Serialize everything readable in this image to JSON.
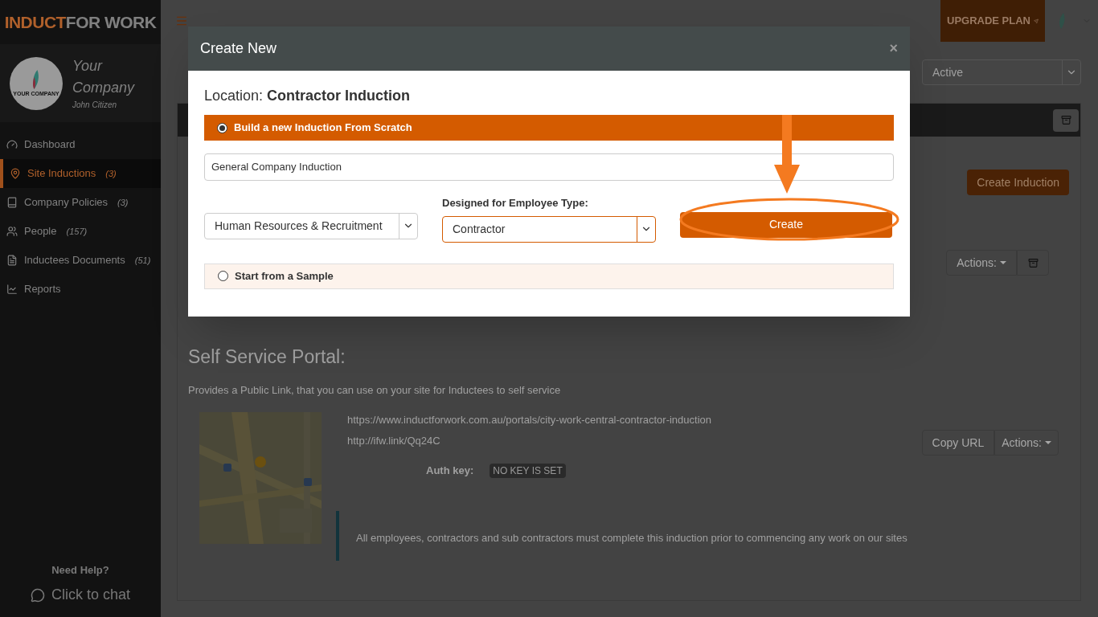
{
  "brand": {
    "logo_left": "INDUCT",
    "logo_right": "FOR WORK"
  },
  "profile": {
    "avatar_text": "YOUR COMPANY",
    "company": "Your Company",
    "user": "John Citizen"
  },
  "sidebar": {
    "items": [
      {
        "kind": "dashboard",
        "label": "Dashboard",
        "selected": false
      },
      {
        "kind": "pin",
        "label": "Site Inductions",
        "count": "(3)",
        "selected": true
      },
      {
        "kind": "book",
        "label": "Company Policies",
        "count": "(3)",
        "selected": false
      },
      {
        "kind": "people",
        "label": "People",
        "count": "(157)",
        "selected": false
      },
      {
        "kind": "document",
        "label": "Inductees Documents",
        "count": "(51)",
        "selected": false
      },
      {
        "kind": "chart",
        "label": "Reports",
        "selected": false
      }
    ]
  },
  "help": {
    "title": "Need Help?",
    "chat": "Click to chat"
  },
  "topbar": {
    "upgrade": "UPGRADE PLAN"
  },
  "page": {
    "status_filter": "Active",
    "create_button": "Create Induction",
    "actions_button": "Actions:",
    "portal": {
      "title": "Self Service Portal:",
      "description": "Provides a Public Link, that you can use on your site for Inductees to self service",
      "url": "https://www.inductforwork.com.au/portals/city-work-central-contractor-induction",
      "short_url": "http://ifw.link/Qq24C",
      "auth_label": "Auth key:",
      "auth_value": "NO KEY IS SET",
      "copy_button": "Copy URL",
      "actions_button": "Actions:",
      "statement": "All employees, contractors and sub contractors must complete this induction prior to commencing any work on our sites"
    }
  },
  "modal": {
    "title": "Create New",
    "close": "×",
    "location_label": "Location:",
    "location_value": "Contractor Induction",
    "options": [
      {
        "label": "Build a new Induction From Scratch",
        "selected": true
      },
      {
        "label": "Start from a Sample",
        "selected": false
      }
    ],
    "name_value": "General Company Induction",
    "department": "Human Resources & Recruitment",
    "employee_type_label": "Designed for Employee Type:",
    "employee_type": "Contractor",
    "create_button": "Create"
  }
}
